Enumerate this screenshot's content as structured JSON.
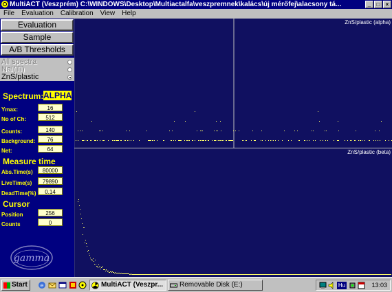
{
  "window": {
    "title": "MultiACT (Veszprém) C:\\WINDOWS\\Desktop\\Multiactalfa\\veszpremnek\\kalács\\új mérőfej\\alacsony tá...",
    "buttons": {
      "minimize": "_",
      "maximize": "□",
      "close": "×"
    }
  },
  "menu": [
    "File",
    "Evaluation",
    "Calibration",
    "View",
    "Help"
  ],
  "nav": {
    "evaluation": "Evaluation",
    "sample": "Sample",
    "thresholds": "A/B Thresholds"
  },
  "detector_options": [
    {
      "label": "All spectra",
      "enabled": false,
      "selected": false
    },
    {
      "label": "NaI(Tl)",
      "enabled": false,
      "selected": false
    },
    {
      "label": "ZnS/plastic",
      "enabled": true,
      "selected": true
    }
  ],
  "spectrum": {
    "heading": "Spectrum:",
    "value": "ALPHA",
    "fields": [
      {
        "label": "Ymax:",
        "value": "16"
      },
      {
        "label": "No of Ch:",
        "value": "512"
      },
      {
        "label": "Counts:",
        "value": "140"
      },
      {
        "label": "Background:",
        "value": "76"
      },
      {
        "label": "Net:",
        "value": "64"
      }
    ]
  },
  "measure_time": {
    "heading": "Measure time",
    "fields": [
      {
        "label": "Abs.Time(s)",
        "value": "80000"
      },
      {
        "label": "LiveTime(s)",
        "value": "79890"
      },
      {
        "label": "DeadTime(%)",
        "value": "0.14"
      }
    ]
  },
  "cursor": {
    "heading": "Cursor",
    "fields": [
      {
        "label": "Position",
        "value": "256"
      },
      {
        "label": "Counts",
        "value": "0"
      }
    ]
  },
  "logo_text": "gamma",
  "plots": {
    "alpha_label": "ZnS/plastic (alpha)",
    "beta_label": "ZnS/plastic (beta)",
    "cursor_channel": 256,
    "channels": 512,
    "trace_color": "#ffff66",
    "background_color": "#101060"
  },
  "taskbar": {
    "start": "Start",
    "tasks": [
      {
        "label": "MultiACT (Veszpr...",
        "active": true
      },
      {
        "label": "Removable Disk (E:)",
        "active": false
      }
    ],
    "tray_lang": "Hu",
    "clock": "13:03"
  }
}
